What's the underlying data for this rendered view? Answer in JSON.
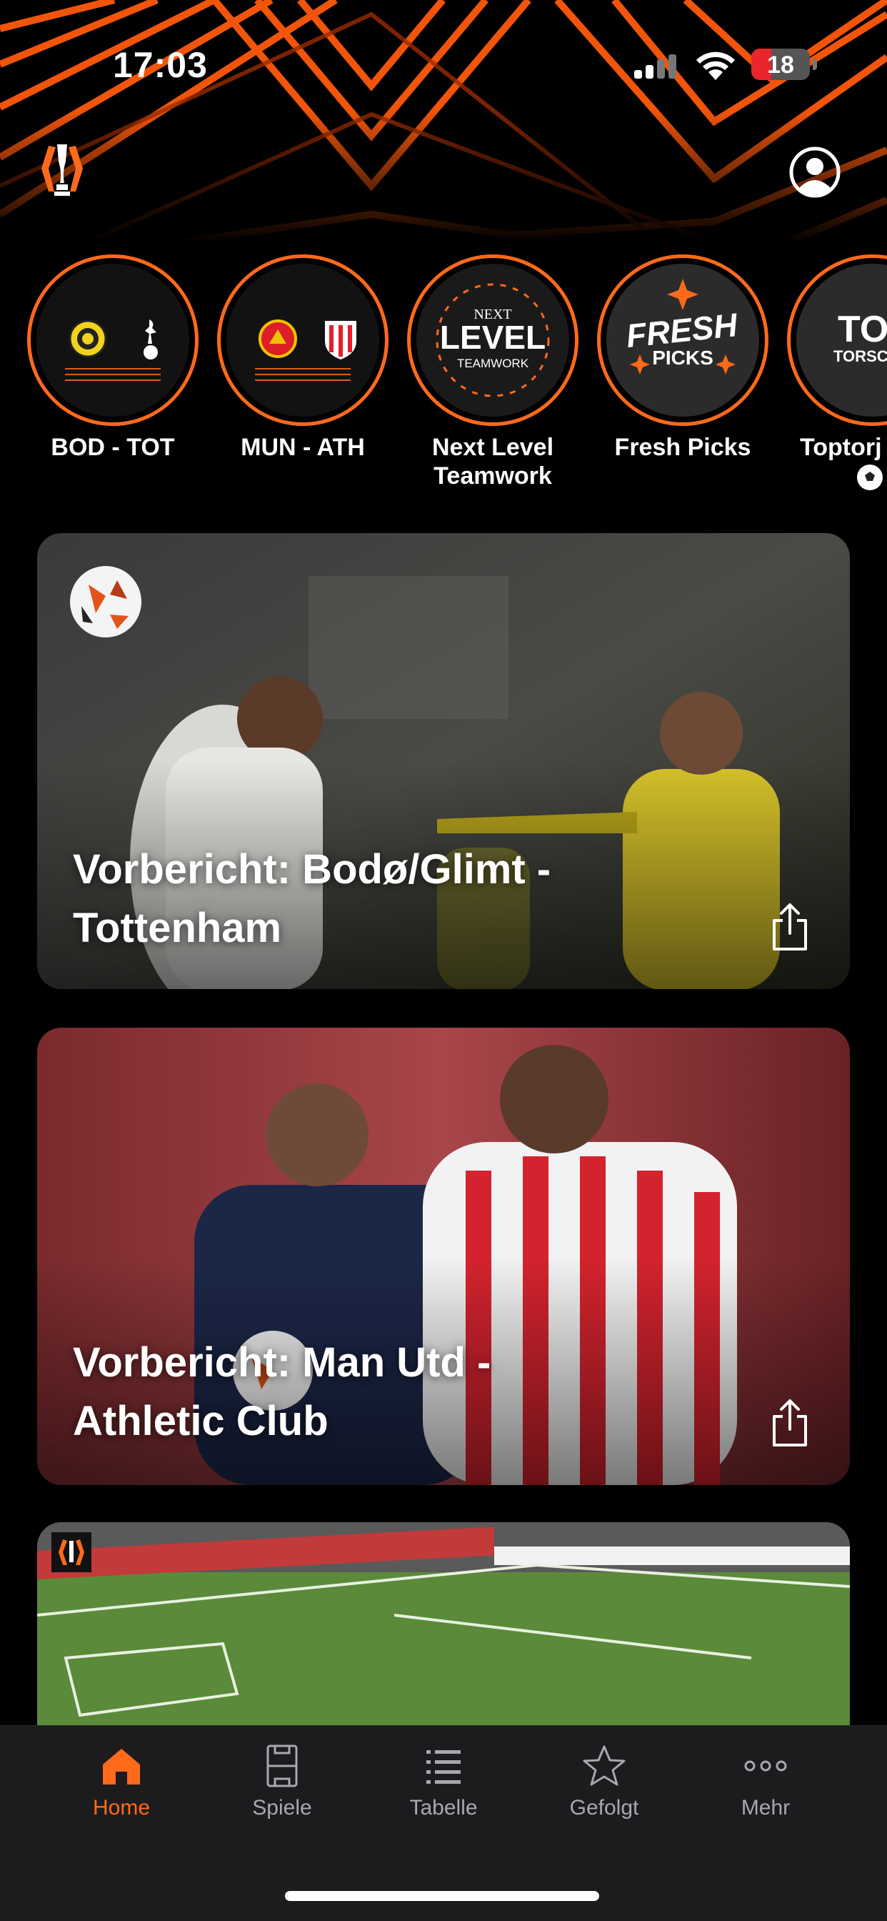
{
  "status": {
    "time": "17:03",
    "battery": "18"
  },
  "colors": {
    "accent": "#ff6a1a",
    "background": "#000000",
    "tabbar": "#1c1c1e"
  },
  "header": {
    "logo_icon": "europa-league-trophy-icon",
    "profile_icon": "user-profile-icon"
  },
  "stories": [
    {
      "label": "BOD - TOT",
      "kind": "match"
    },
    {
      "label": "MUN - ATH",
      "kind": "match"
    },
    {
      "label": "Next Level Teamwork",
      "kind": "promo",
      "art_lines": [
        "NEXT",
        "LEVEL",
        "TEAMWORK"
      ]
    },
    {
      "label": "Fresh Picks",
      "kind": "promo",
      "art_lines": [
        "FRESH",
        "PICKS"
      ]
    },
    {
      "label": "Toptorj",
      "kind": "promo",
      "art_lines": [
        "TO",
        "TORSCHÜ"
      ]
    }
  ],
  "articles": [
    {
      "title": "Vorbericht: Bodø/Glimt - Tottenham"
    },
    {
      "title": "Vorbericht: Man Utd - Athletic Club"
    },
    {
      "title": ""
    }
  ],
  "tabs": [
    {
      "label": "Home",
      "icon": "home-icon",
      "active": true
    },
    {
      "label": "Spiele",
      "icon": "pitch-icon",
      "active": false
    },
    {
      "label": "Tabelle",
      "icon": "list-icon",
      "active": false
    },
    {
      "label": "Gefolgt",
      "icon": "star-icon",
      "active": false
    },
    {
      "label": "Mehr",
      "icon": "more-icon",
      "active": false
    }
  ]
}
